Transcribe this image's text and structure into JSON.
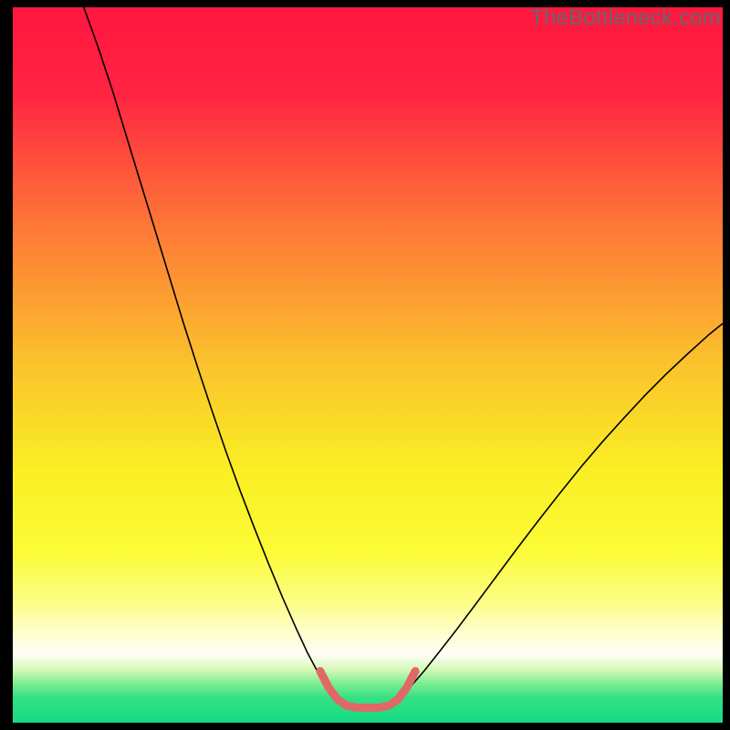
{
  "watermark": "TheBottleneck.com",
  "chart_data": {
    "type": "line",
    "title": "",
    "xlabel": "",
    "ylabel": "",
    "xlim": [
      0,
      100
    ],
    "ylim": [
      0,
      100
    ],
    "gradient_stops": [
      {
        "offset": 0.0,
        "color": "#ff173f"
      },
      {
        "offset": 0.12,
        "color": "#ff2442"
      },
      {
        "offset": 0.3,
        "color": "#fd7537"
      },
      {
        "offset": 0.5,
        "color": "#fbc32c"
      },
      {
        "offset": 0.65,
        "color": "#faef24"
      },
      {
        "offset": 0.76,
        "color": "#fbfb36"
      },
      {
        "offset": 0.83,
        "color": "#fdfd84"
      },
      {
        "offset": 0.88,
        "color": "#fefed6"
      },
      {
        "offset": 0.905,
        "color": "#fefef7"
      },
      {
        "offset": 0.925,
        "color": "#d7f9b8"
      },
      {
        "offset": 0.945,
        "color": "#7fed91"
      },
      {
        "offset": 0.965,
        "color": "#33e184"
      },
      {
        "offset": 1.0,
        "color": "#14db84"
      }
    ],
    "series": [
      {
        "name": "bottleneck-curve-left",
        "color": "#000000",
        "width": 1.6,
        "points": [
          {
            "x": 10.0,
            "y": 100.0
          },
          {
            "x": 12.0,
            "y": 94.5
          },
          {
            "x": 14.0,
            "y": 88.5
          },
          {
            "x": 16.0,
            "y": 82.0
          },
          {
            "x": 18.0,
            "y": 75.5
          },
          {
            "x": 20.0,
            "y": 69.0
          },
          {
            "x": 22.0,
            "y": 62.5
          },
          {
            "x": 24.0,
            "y": 56.0
          },
          {
            "x": 26.0,
            "y": 49.8
          },
          {
            "x": 28.0,
            "y": 43.8
          },
          {
            "x": 30.0,
            "y": 38.0
          },
          {
            "x": 32.0,
            "y": 32.5
          },
          {
            "x": 34.0,
            "y": 27.3
          },
          {
            "x": 36.0,
            "y": 22.3
          },
          {
            "x": 38.0,
            "y": 17.5
          },
          {
            "x": 40.0,
            "y": 13.0
          },
          {
            "x": 41.5,
            "y": 9.8
          },
          {
            "x": 43.0,
            "y": 7.0
          },
          {
            "x": 44.5,
            "y": 4.7
          },
          {
            "x": 46.0,
            "y": 3.0
          }
        ]
      },
      {
        "name": "bottleneck-curve-right",
        "color": "#000000",
        "width": 1.6,
        "points": [
          {
            "x": 54.0,
            "y": 3.0
          },
          {
            "x": 56.0,
            "y": 5.0
          },
          {
            "x": 58.0,
            "y": 7.3
          },
          {
            "x": 60.0,
            "y": 9.8
          },
          {
            "x": 62.5,
            "y": 13.0
          },
          {
            "x": 65.0,
            "y": 16.3
          },
          {
            "x": 68.0,
            "y": 20.3
          },
          {
            "x": 71.0,
            "y": 24.3
          },
          {
            "x": 74.0,
            "y": 28.2
          },
          {
            "x": 77.0,
            "y": 32.0
          },
          {
            "x": 80.0,
            "y": 35.7
          },
          {
            "x": 83.0,
            "y": 39.2
          },
          {
            "x": 86.0,
            "y": 42.5
          },
          {
            "x": 89.0,
            "y": 45.7
          },
          {
            "x": 92.0,
            "y": 48.7
          },
          {
            "x": 95.0,
            "y": 51.5
          },
          {
            "x": 98.0,
            "y": 54.2
          },
          {
            "x": 100.0,
            "y": 55.8
          }
        ]
      },
      {
        "name": "optimal-zone",
        "color": "#e06968",
        "width": 9,
        "linecap": "round",
        "points": [
          {
            "x": 43.3,
            "y": 7.2
          },
          {
            "x": 44.5,
            "y": 4.9
          },
          {
            "x": 45.7,
            "y": 3.3
          },
          {
            "x": 47.0,
            "y": 2.4
          },
          {
            "x": 48.5,
            "y": 2.1
          },
          {
            "x": 50.0,
            "y": 2.1
          },
          {
            "x": 51.5,
            "y": 2.1
          },
          {
            "x": 53.0,
            "y": 2.4
          },
          {
            "x": 54.3,
            "y": 3.3
          },
          {
            "x": 55.5,
            "y": 4.9
          },
          {
            "x": 56.7,
            "y": 7.2
          }
        ]
      }
    ]
  }
}
